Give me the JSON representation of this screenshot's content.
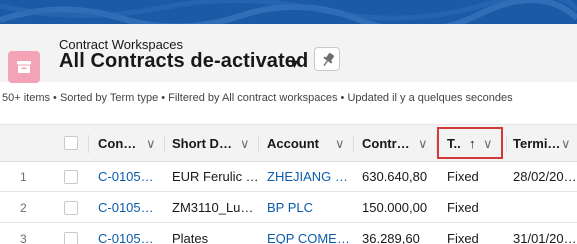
{
  "header": {
    "object_label": "Contract Workspaces",
    "list_title": "All Contracts de-activated",
    "title_caret": "▼"
  },
  "summary": "50+ items • Sorted by Term type • Filtered by All contract workspaces • Updated il y a quelques secondes",
  "table": {
    "columns": [
      {
        "label": "Con…",
        "chevron": "∨"
      },
      {
        "label": "Short D…",
        "chevron": "∨"
      },
      {
        "label": "Account",
        "chevron": "∨"
      },
      {
        "label": "Contr…",
        "chevron": "∨"
      },
      {
        "label": "T..",
        "sort_indicator": "↑",
        "chevron": "∨"
      },
      {
        "label": "Termi…",
        "chevron": "∨"
      }
    ],
    "rows": [
      {
        "num": "1",
        "contract": "C-0105…",
        "short_desc": "EUR Ferulic …",
        "account": "ZHEJIANG …",
        "value": "630.640,80",
        "term": "Fixed",
        "termination": "28/02/20…"
      },
      {
        "num": "2",
        "contract": "C-0105…",
        "short_desc": "ZM3110_Lu…",
        "account": "BP PLC",
        "value": "150.000,00",
        "term": "Fixed",
        "termination": ""
      },
      {
        "num": "3",
        "contract": "C-0105…",
        "short_desc": "Plates",
        "account": "EQP COME…",
        "value": "36.289,60",
        "term": "Fixed",
        "termination": "31/01/20…"
      }
    ]
  },
  "colors": {
    "banner": "#1b5aa6",
    "object_icon": "#f4a3b6",
    "link": "#0b5cab",
    "sort_highlight": "#d23a3a"
  },
  "icons": [
    "archive-icon",
    "pin-icon",
    "chevron-down-icon",
    "sort-ascending-icon"
  ]
}
